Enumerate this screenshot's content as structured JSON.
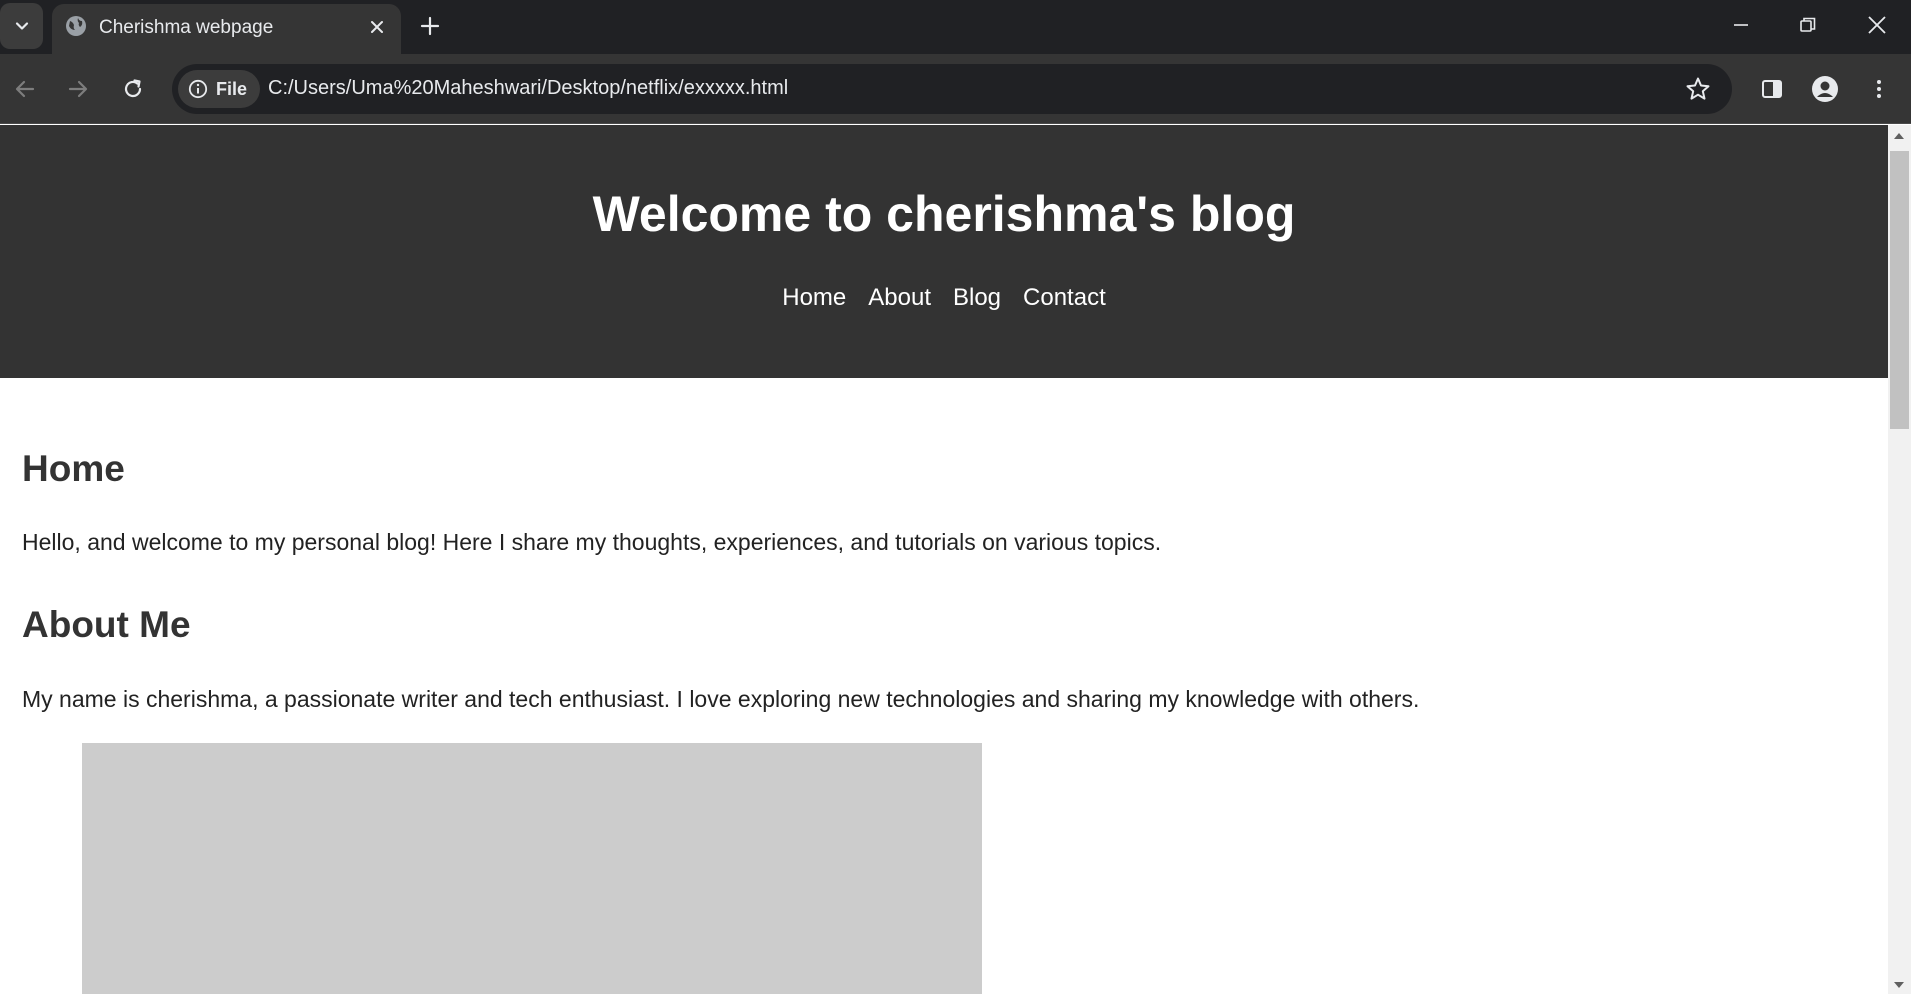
{
  "browser": {
    "tab": {
      "title": "Cherishma webpage",
      "favicon": "globe-icon"
    },
    "icons": {
      "tab_search": "chevron-down-icon",
      "tab_close": "close-icon",
      "new_tab": "plus-icon",
      "minimize": "minimize-icon",
      "restore": "restore-icon",
      "close_window": "close-icon",
      "back": "back-arrow-icon",
      "forward": "forward-arrow-icon",
      "reload": "reload-icon",
      "site_info": "info-icon",
      "bookmark": "star-icon",
      "side_panel": "side-panel-icon",
      "profile": "profile-icon",
      "menu": "kebab-menu-icon"
    },
    "address_bar": {
      "chip_label": "File",
      "url": "C:/Users/Uma%20Maheshwari/Desktop/netflix/exxxxx.html"
    }
  },
  "page": {
    "header": {
      "title": "Welcome to cherishma's blog",
      "nav": [
        {
          "label": "Home"
        },
        {
          "label": "About"
        },
        {
          "label": "Blog"
        },
        {
          "label": "Contact"
        }
      ]
    },
    "sections": {
      "home": {
        "heading": "Home",
        "text": "Hello, and welcome to my personal blog! Here I share my thoughts, experiences, and tutorials on various topics."
      },
      "about": {
        "heading": "About Me",
        "text": "My name is cherishma, a passionate writer and tech enthusiast. I love exploring new technologies and sharing my knowledge with others."
      }
    }
  },
  "colors": {
    "chrome_dark": "#202124",
    "chrome_toolbar": "#353535",
    "header_bg": "#333333",
    "heading_text": "#333333",
    "placeholder_bg": "#cccccc"
  }
}
